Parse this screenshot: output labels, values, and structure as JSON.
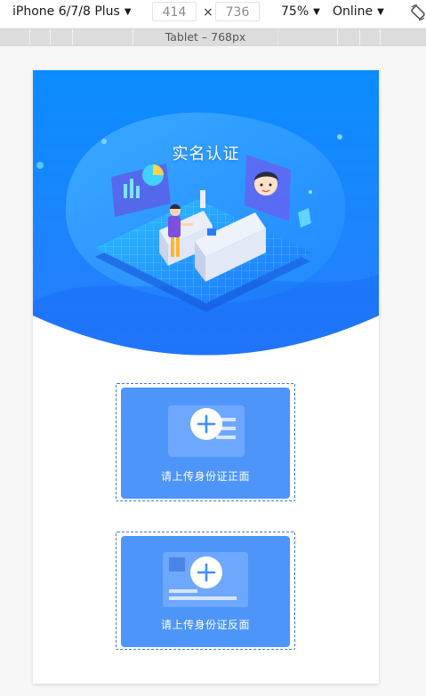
{
  "toolbar": {
    "device": "iPhone 6/7/8 Plus",
    "width": "414",
    "height": "736",
    "times": "×",
    "zoom": "75%",
    "throttle": "Online"
  },
  "media_bar": {
    "label": "Tablet – 768px"
  },
  "page": {
    "title": "实名认证",
    "upload_front": "请上传身份证正面",
    "upload_back": "请上传身份证反面"
  },
  "colors": {
    "hero_blue": "#1a86ff",
    "card_blue": "#4d95f9",
    "dashed_border": "#3a7bd5"
  }
}
